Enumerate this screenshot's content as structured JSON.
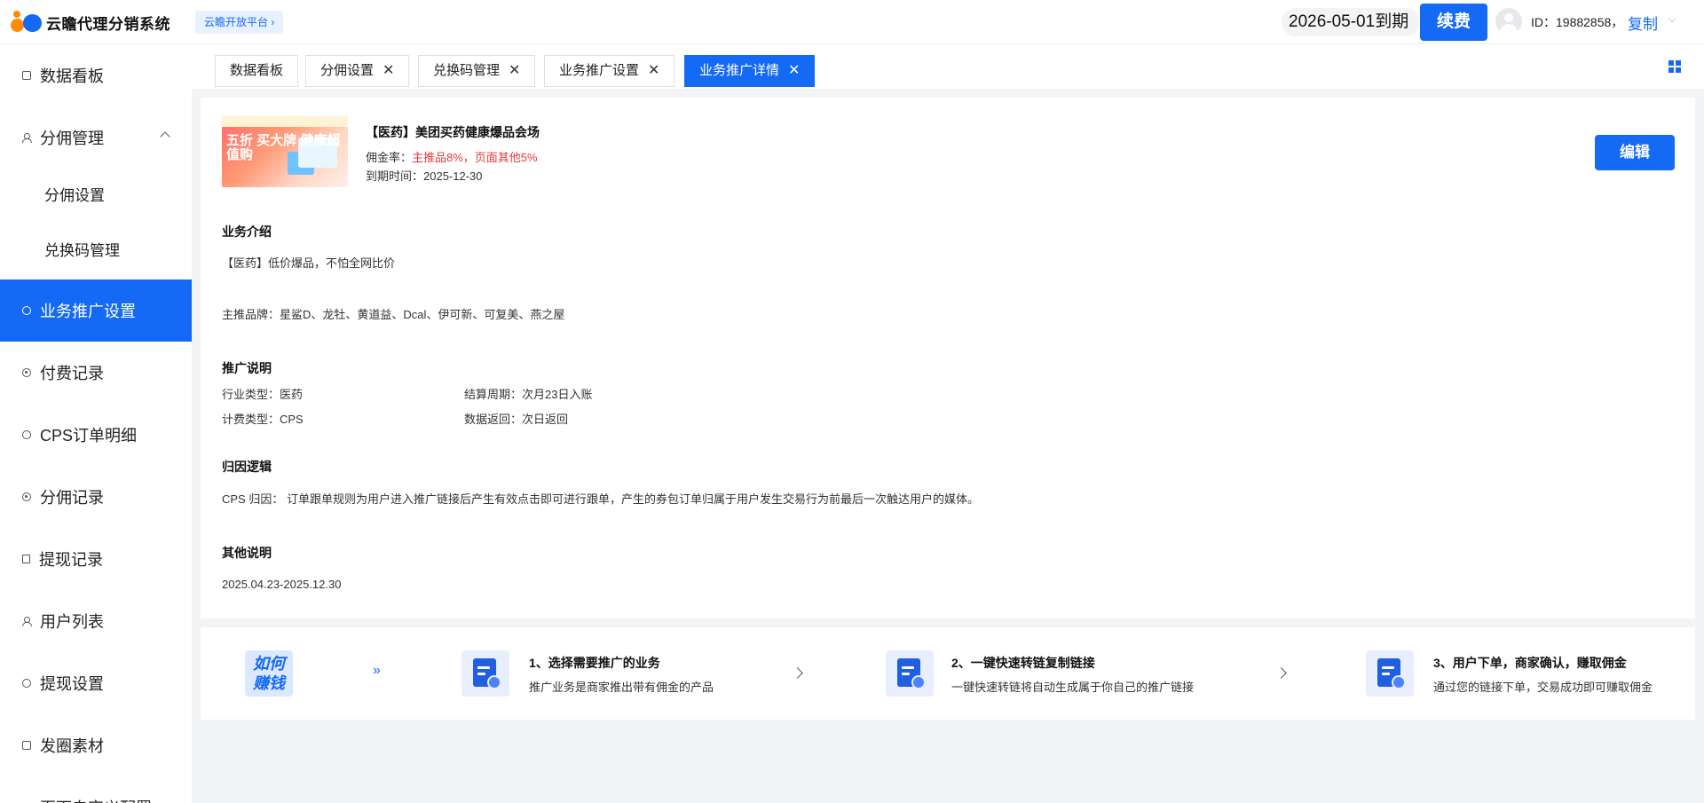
{
  "header": {
    "app_title": "云瞻代理分销系统",
    "open_platform": "云瞻开放平台",
    "expire_text": "2026-05-01到期",
    "renew_label": "续费",
    "user_id": "ID：19882858，",
    "copy_label": "复制"
  },
  "sidebar": {
    "items": [
      {
        "label": "数据看板",
        "icon": "dashboard-icon"
      },
      {
        "label": "分佣管理",
        "icon": "person-icon"
      },
      {
        "label": "分佣设置"
      },
      {
        "label": "兑换码管理"
      },
      {
        "label": "业务推广设置",
        "icon": "promo-icon"
      },
      {
        "label": "付费记录",
        "icon": "payment-icon"
      },
      {
        "label": "CPS订单明细",
        "icon": "order-icon"
      },
      {
        "label": "分佣记录",
        "icon": "commission-icon"
      },
      {
        "label": "提现记录",
        "icon": "withdraw-icon"
      },
      {
        "label": "用户列表",
        "icon": "users-icon"
      },
      {
        "label": "提现设置",
        "icon": "settings-icon"
      },
      {
        "label": "发圈素材",
        "icon": "material-icon"
      },
      {
        "label": "页面自定义配置",
        "icon": "custom-icon"
      }
    ],
    "active_color": "#1469f5"
  },
  "tabs": [
    {
      "label": "数据看板",
      "closable": false
    },
    {
      "label": "分佣设置",
      "closable": true
    },
    {
      "label": "兑换码管理",
      "closable": true
    },
    {
      "label": "业务推广设置",
      "closable": true
    },
    {
      "label": "业务推广详情",
      "closable": true,
      "active": true
    }
  ],
  "detail": {
    "thumb_text": "五折 买大牌 健康超值购",
    "product_name": "【医药】美团买药健康爆品会场",
    "commission_label": "佣金率：",
    "commission_value": "主推品8%，页面其他5%",
    "expire_label": "到期时间：",
    "expire_value": "2025-12-30",
    "edit_label": "编辑",
    "intro_title": "业务介绍",
    "intro_text": "【医药】低价爆品，不怕全网比价",
    "brands_text": "主推品牌：星鲨D、龙牡、黄道益、Dcal、伊可新、可复美、燕之屋",
    "promo_title": "推广说明",
    "industry": "行业类型：医药",
    "billing": "计费类型：CPS",
    "settle": "结算周期：次月23日入账",
    "data_return": "数据返回：次日返回",
    "attribution_title": "归因逻辑",
    "attribution_text": "CPS 归因： 订单跟单规则为用户进入推广链接后产生有效点击即可进行跟单，产生的券包订单归属于用户发生交易行为前最后一次触达用户的媒体。",
    "other_title": "其他说明",
    "other_text": "2025.04.23-2025.12.30"
  },
  "steps": {
    "how_label": "如何 赚钱",
    "items": [
      {
        "title": "1、选择需要推广的业务",
        "desc": "推广业务是商家推出带有佣金的产品"
      },
      {
        "title": "2、一键快速转链复制链接",
        "desc": "一键快速转链将自动生成属于你自己的推广链接"
      },
      {
        "title": "3、用户下单，商家确认，赚取佣金",
        "desc": "通过您的链接下单，交易成功即可赚取佣金"
      }
    ]
  }
}
